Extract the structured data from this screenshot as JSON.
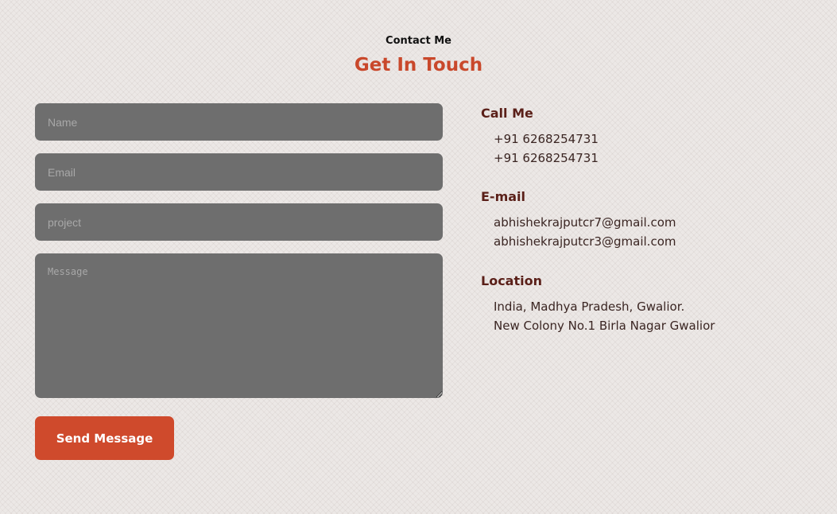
{
  "header": {
    "subtitle": "Contact Me",
    "title": "Get In Touch"
  },
  "form": {
    "name_placeholder": "Name",
    "email_placeholder": "Email",
    "project_placeholder": "project",
    "message_placeholder": "Message",
    "submit_label": "Send Message"
  },
  "contact": {
    "call": {
      "heading": "Call Me",
      "lines": [
        "+91 6268254731",
        "+91 6268254731"
      ]
    },
    "email": {
      "heading": "E-mail",
      "lines": [
        "abhishekrajputcr7@gmail.com",
        "abhishekrajputcr3@gmail.com"
      ]
    },
    "location": {
      "heading": "Location",
      "lines": [
        "India, Madhya Pradesh, Gwalior.",
        "New Colony No.1 Birla Nagar Gwalior"
      ]
    }
  },
  "colors": {
    "accent": "#cf4a2c",
    "title": "#c9482b",
    "heading": "#5a1f18",
    "field_bg": "#6e6e6e",
    "page_bg": "#ece8e6"
  }
}
